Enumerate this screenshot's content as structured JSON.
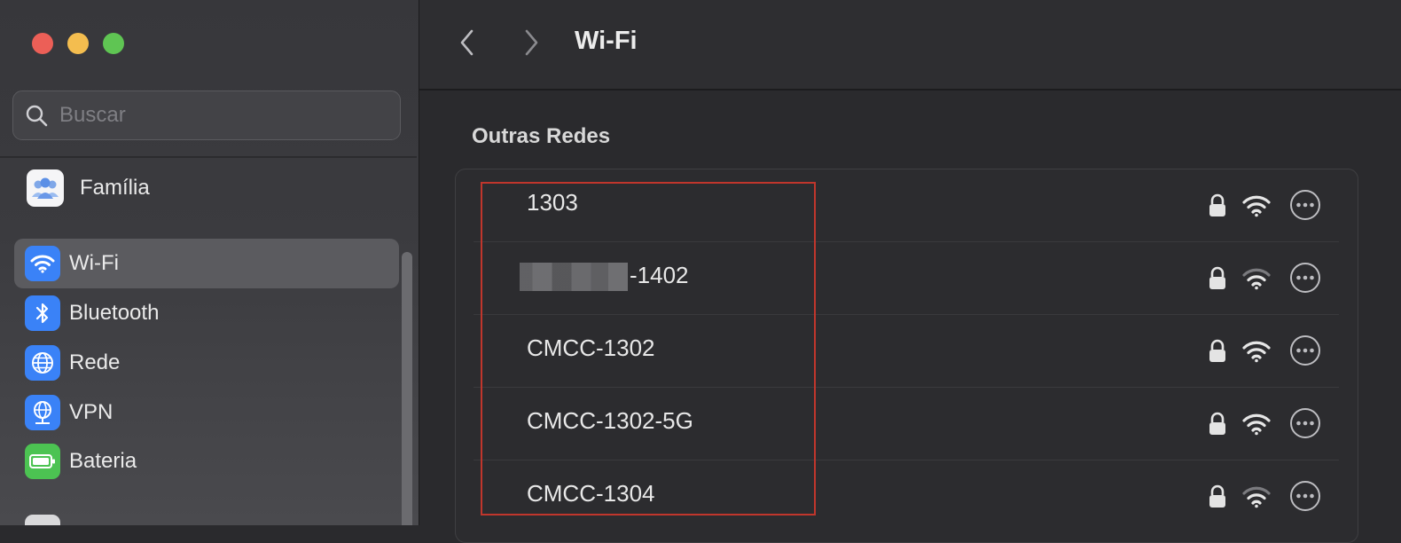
{
  "window": {
    "title": "Wi-Fi"
  },
  "search": {
    "placeholder": "Buscar"
  },
  "sidebar": {
    "family": {
      "label": "Família"
    },
    "items": [
      {
        "label": "Wi-Fi",
        "icon": "wifi-icon",
        "color": "#3a82f7",
        "selected": true
      },
      {
        "label": "Bluetooth",
        "icon": "bluetooth-icon",
        "color": "#3a82f7",
        "selected": false
      },
      {
        "label": "Rede",
        "icon": "globe-icon",
        "color": "#3a82f7",
        "selected": false
      },
      {
        "label": "VPN",
        "icon": "vpn-globe-icon",
        "color": "#3a82f7",
        "selected": false
      },
      {
        "label": "Bateria",
        "icon": "battery-icon",
        "color": "#4cc352",
        "selected": false
      }
    ]
  },
  "main": {
    "section_heading": "Outras Redes",
    "networks": [
      {
        "name": "1303",
        "redacted_prefix": false,
        "locked": true,
        "signal": "full"
      },
      {
        "name": "-1402",
        "redacted_prefix": true,
        "locked": true,
        "signal": "medium"
      },
      {
        "name": "CMCC-1302",
        "redacted_prefix": false,
        "locked": true,
        "signal": "full"
      },
      {
        "name": "CMCC-1302-5G",
        "redacted_prefix": false,
        "locked": true,
        "signal": "full"
      },
      {
        "name": "CMCC-1304",
        "redacted_prefix": false,
        "locked": true,
        "signal": "medium"
      }
    ]
  },
  "colors": {
    "accent_blue": "#3a82f7",
    "battery_green": "#4cc352",
    "highlight_red": "#c0362c"
  }
}
